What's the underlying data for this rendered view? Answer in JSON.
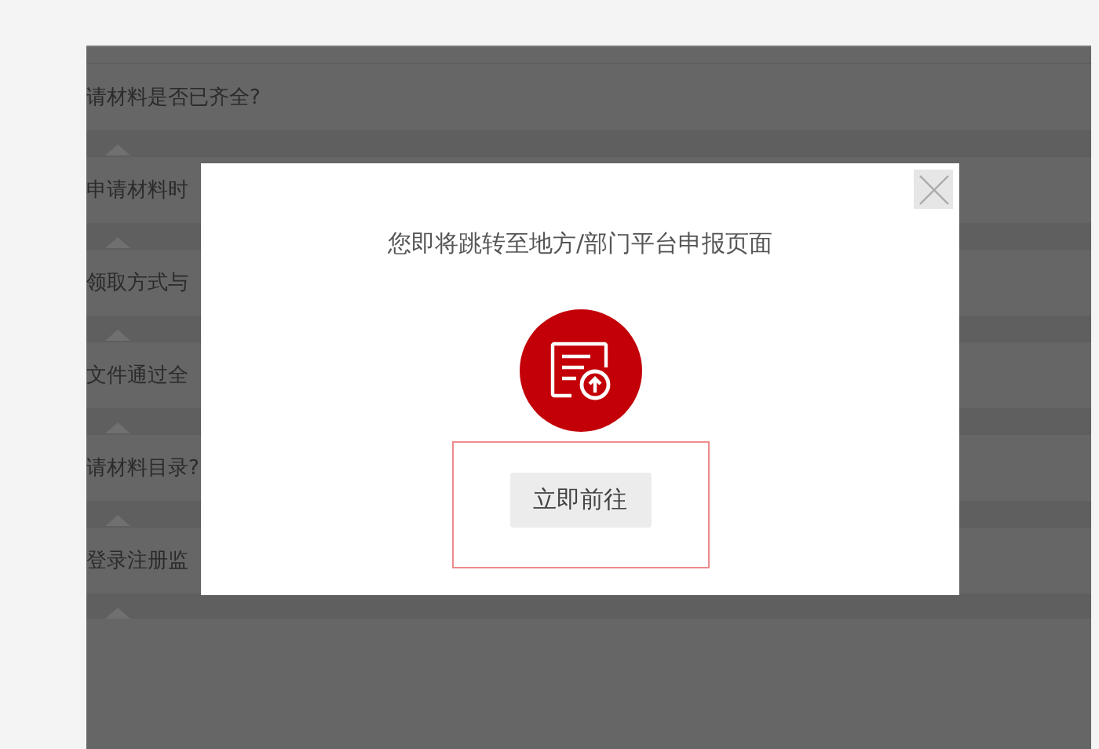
{
  "background_list": {
    "items": [
      {
        "text": "请材料是否已齐全?"
      },
      {
        "text": "申请材料时"
      },
      {
        "text": "领取方式与"
      },
      {
        "text": "文件通过全"
      },
      {
        "text": "请材料目录?"
      },
      {
        "text": "登录注册监"
      }
    ]
  },
  "dialog": {
    "message": "您即将跳转至地方/部门平台申报页面",
    "button": "立即前往"
  }
}
